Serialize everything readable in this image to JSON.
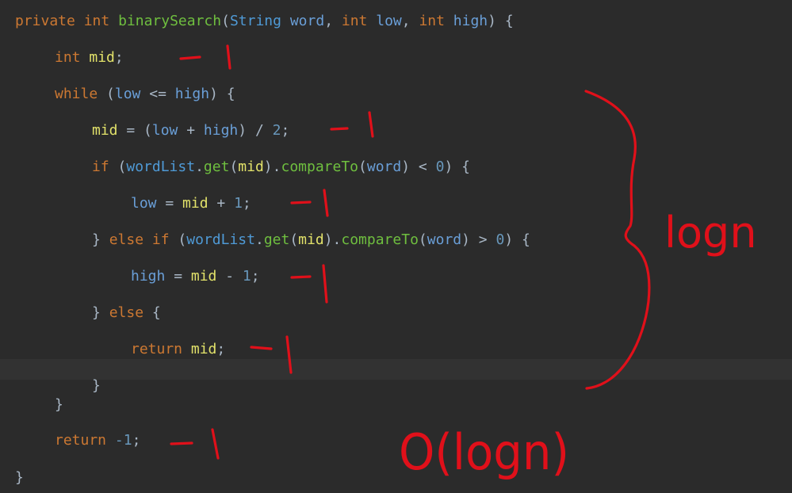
{
  "editor": {
    "code_lines": [
      [
        {
          "t": "private",
          "c": "kw"
        },
        {
          "t": " ",
          "c": "plain"
        },
        {
          "t": "int",
          "c": "kw"
        },
        {
          "t": " ",
          "c": "plain"
        },
        {
          "t": "binarySearch",
          "c": "fn"
        },
        {
          "t": "(",
          "c": "plain"
        },
        {
          "t": "String",
          "c": "type"
        },
        {
          "t": " ",
          "c": "plain"
        },
        {
          "t": "word",
          "c": "param"
        },
        {
          "t": ", ",
          "c": "plain"
        },
        {
          "t": "int",
          "c": "kw"
        },
        {
          "t": " ",
          "c": "plain"
        },
        {
          "t": "low",
          "c": "param"
        },
        {
          "t": ", ",
          "c": "plain"
        },
        {
          "t": "int",
          "c": "kw"
        },
        {
          "t": " ",
          "c": "plain"
        },
        {
          "t": "high",
          "c": "param"
        },
        {
          "t": ") {",
          "c": "plain"
        }
      ],
      [
        {
          "t": "int",
          "c": "kw"
        },
        {
          "t": " ",
          "c": "plain"
        },
        {
          "t": "mid",
          "c": "var"
        },
        {
          "t": ";",
          "c": "plain"
        }
      ],
      [
        {
          "t": "while",
          "c": "kw"
        },
        {
          "t": " (",
          "c": "plain"
        },
        {
          "t": "low",
          "c": "param"
        },
        {
          "t": " <= ",
          "c": "plain"
        },
        {
          "t": "high",
          "c": "param"
        },
        {
          "t": ") {",
          "c": "plain"
        }
      ],
      [
        {
          "t": "mid",
          "c": "var"
        },
        {
          "t": " = (",
          "c": "plain"
        },
        {
          "t": "low",
          "c": "param"
        },
        {
          "t": " + ",
          "c": "plain"
        },
        {
          "t": "high",
          "c": "param"
        },
        {
          "t": ") / ",
          "c": "plain"
        },
        {
          "t": "2",
          "c": "num"
        },
        {
          "t": ";",
          "c": "plain"
        }
      ],
      [
        {
          "t": "if",
          "c": "kw"
        },
        {
          "t": " (",
          "c": "plain"
        },
        {
          "t": "wordList",
          "c": "type"
        },
        {
          "t": ".",
          "c": "plain"
        },
        {
          "t": "get",
          "c": "fn"
        },
        {
          "t": "(",
          "c": "plain"
        },
        {
          "t": "mid",
          "c": "var"
        },
        {
          "t": ").",
          "c": "plain"
        },
        {
          "t": "compareTo",
          "c": "fn"
        },
        {
          "t": "(",
          "c": "plain"
        },
        {
          "t": "word",
          "c": "param"
        },
        {
          "t": ") < ",
          "c": "plain"
        },
        {
          "t": "0",
          "c": "num"
        },
        {
          "t": ") {",
          "c": "plain"
        }
      ],
      [
        {
          "t": "low",
          "c": "param"
        },
        {
          "t": " = ",
          "c": "plain"
        },
        {
          "t": "mid",
          "c": "var"
        },
        {
          "t": " + ",
          "c": "plain"
        },
        {
          "t": "1",
          "c": "num"
        },
        {
          "t": ";",
          "c": "plain"
        }
      ],
      [
        {
          "t": "} ",
          "c": "plain"
        },
        {
          "t": "else",
          "c": "kw"
        },
        {
          "t": " ",
          "c": "plain"
        },
        {
          "t": "if",
          "c": "kw"
        },
        {
          "t": " (",
          "c": "plain"
        },
        {
          "t": "wordList",
          "c": "type"
        },
        {
          "t": ".",
          "c": "plain"
        },
        {
          "t": "get",
          "c": "fn"
        },
        {
          "t": "(",
          "c": "plain"
        },
        {
          "t": "mid",
          "c": "var"
        },
        {
          "t": ").",
          "c": "plain"
        },
        {
          "t": "compareTo",
          "c": "fn"
        },
        {
          "t": "(",
          "c": "plain"
        },
        {
          "t": "word",
          "c": "param"
        },
        {
          "t": ") > ",
          "c": "plain"
        },
        {
          "t": "0",
          "c": "num"
        },
        {
          "t": ") {",
          "c": "plain"
        }
      ],
      [
        {
          "t": "high",
          "c": "param"
        },
        {
          "t": " = ",
          "c": "plain"
        },
        {
          "t": "mid",
          "c": "var"
        },
        {
          "t": " - ",
          "c": "plain"
        },
        {
          "t": "1",
          "c": "num"
        },
        {
          "t": ";",
          "c": "plain"
        }
      ],
      [
        {
          "t": "} ",
          "c": "plain"
        },
        {
          "t": "else",
          "c": "kw"
        },
        {
          "t": " {",
          "c": "plain"
        }
      ],
      [
        {
          "t": "return",
          "c": "kw"
        },
        {
          "t": " ",
          "c": "plain"
        },
        {
          "t": "mid",
          "c": "var"
        },
        {
          "t": ";",
          "c": "plain"
        }
      ],
      [
        {
          "t": "}",
          "c": "plain"
        }
      ],
      [
        {
          "t": "}",
          "c": "plain"
        }
      ],
      [
        {
          "t": "return",
          "c": "kw"
        },
        {
          "t": " ",
          "c": "plain"
        },
        {
          "t": "-1",
          "c": "num"
        },
        {
          "t": ";",
          "c": "plain"
        }
      ],
      [
        {
          "t": "}",
          "c": "plain"
        }
      ]
    ]
  },
  "annotations": {
    "loop_label": "logn",
    "total_label": "O(logn)",
    "tick_mark": "- 1",
    "ink_color": "#e0101a"
  }
}
